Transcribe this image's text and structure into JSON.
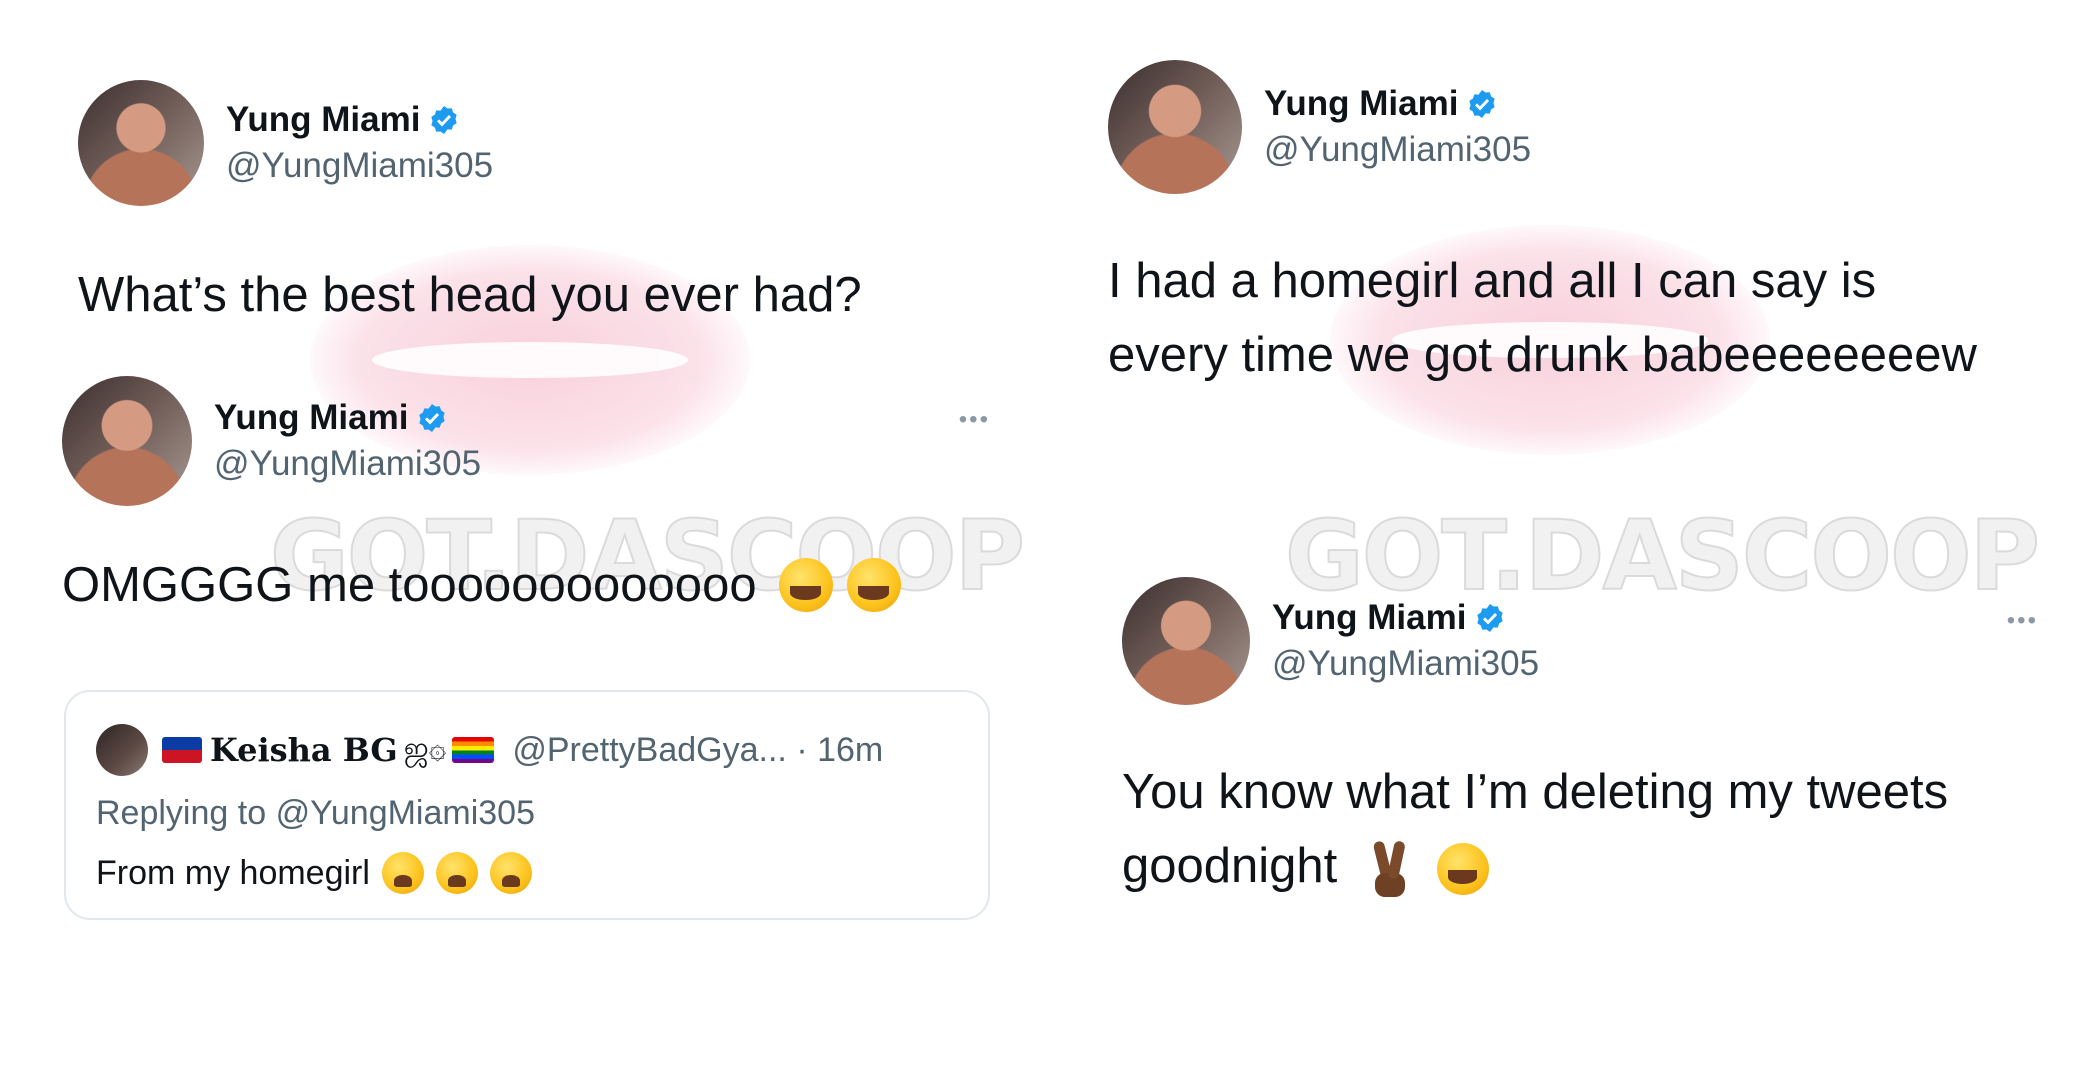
{
  "watermark": {
    "text": "GOT.DASCOOP"
  },
  "tweets": [
    {
      "display_name": "Yung Miami",
      "handle": "@YungMiami305",
      "text": "What’s the best head you ever had?"
    },
    {
      "display_name": "Yung Miami",
      "handle": "@YungMiami305",
      "text": "OMGGGG me tooooooooooooo",
      "more": "•••",
      "quote": {
        "name": "Keisha BG",
        "symbols": "ஜ۞",
        "handle": "@PrettyBadGya... · 16m",
        "replying_label": "Replying to",
        "replying_handle": "@YungMiami305",
        "text": "From my homegirl"
      }
    },
    {
      "display_name": "Yung Miami",
      "handle": "@YungMiami305",
      "text": "I had a homegirl and all I can say is every time we got drunk babeeeeeeeew"
    },
    {
      "display_name": "Yung Miami",
      "handle": "@YungMiami305",
      "text": "You know what I’m deleting my tweets goodnight",
      "more": "•••"
    }
  ],
  "icons": {
    "verified": "verified-badge-icon",
    "more": "more-options-icon",
    "laugh": "rolling-on-floor-laughing-emoji",
    "weary": "weary-face-emoji",
    "victory": "victory-hand-emoji"
  },
  "colors": {
    "verified_blue": "#1d9bf0",
    "secondary_text": "#536471",
    "watermark_pink": "#f8c9d6"
  }
}
